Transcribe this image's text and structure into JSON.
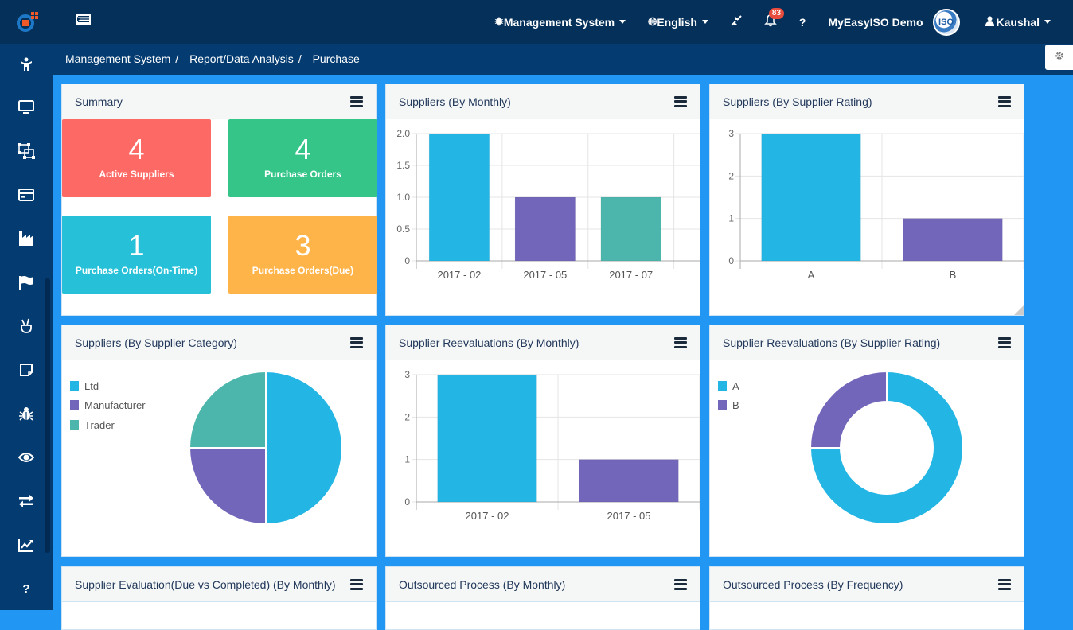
{
  "topbar": {
    "system_menu": "Management System",
    "language": "English",
    "notifications_count": "83",
    "help": "?",
    "company": "MyEasyISO Demo",
    "avatar_text": "ISO",
    "user": "Kaushal"
  },
  "breadcrumb": {
    "items": [
      "Management System",
      "Report/Data Analysis",
      "Purchase"
    ],
    "separator": "/"
  },
  "sidebar": {
    "items": [
      "person-icon",
      "monitor-icon",
      "object-group-icon",
      "credit-card-icon",
      "industry-icon",
      "flag-icon",
      "hand-peace-icon",
      "sticky-note-icon",
      "bug-icon",
      "eye-icon",
      "exchange-icon",
      "line-chart-icon",
      "question-icon"
    ]
  },
  "colors": {
    "blue": "#23b5e3",
    "purple": "#7266ba",
    "teal": "#4db6ac",
    "red": "#fd6a66",
    "green": "#35c589",
    "cyan": "#26c1d8",
    "orange": "#ffb44a"
  },
  "summary": {
    "title": "Summary",
    "tiles": [
      {
        "value": "4",
        "label": "Active Suppliers",
        "color": "#fd6a66"
      },
      {
        "value": "4",
        "label": "Purchase Orders",
        "color": "#35c589"
      },
      {
        "value": "1",
        "label": "Purchase Orders(On-Time)",
        "color": "#26c1d8"
      },
      {
        "value": "3",
        "label": "Purchase Orders(Due)",
        "color": "#ffb44a"
      }
    ]
  },
  "panels": {
    "bottom_row": [
      "Supplier Evaluation(Due vs Completed) (By Monthly)",
      "Outsourced Process (By Monthly)",
      "Outsourced Process (By Frequency)"
    ]
  },
  "chart_data": [
    {
      "id": "suppliers_monthly",
      "type": "bar",
      "title": "Suppliers (By Monthly)",
      "categories": [
        "2017 - 02",
        "2017 - 05",
        "2017 - 07"
      ],
      "values": [
        2,
        1,
        1
      ],
      "colors": [
        "#23b5e3",
        "#7266ba",
        "#4db6ac"
      ],
      "yticks": [
        "0",
        "0.5",
        "1.0",
        "1.5",
        "2.0"
      ],
      "ylim": [
        0,
        2
      ],
      "grid": true,
      "xlabel": "",
      "ylabel": ""
    },
    {
      "id": "suppliers_rating",
      "type": "bar",
      "title": "Suppliers (By Supplier Rating)",
      "categories": [
        "A",
        "B"
      ],
      "values": [
        3,
        1
      ],
      "colors": [
        "#23b5e3",
        "#7266ba"
      ],
      "yticks": [
        "0",
        "1",
        "2",
        "3"
      ],
      "ylim": [
        0,
        3
      ],
      "grid": true,
      "xlabel": "",
      "ylabel": ""
    },
    {
      "id": "suppliers_category",
      "type": "pie",
      "title": "Suppliers (By Supplier Category)",
      "categories": [
        "Ltd",
        "Manufacturer",
        "Trader"
      ],
      "values": [
        2,
        1,
        1
      ],
      "colors": [
        "#23b5e3",
        "#7266ba",
        "#4db6ac"
      ],
      "legend": "top-left"
    },
    {
      "id": "reevaluations_monthly",
      "type": "bar",
      "title": "Supplier Reevaluations (By Monthly)",
      "categories": [
        "2017 - 02",
        "2017 - 05"
      ],
      "values": [
        3,
        1
      ],
      "colors": [
        "#23b5e3",
        "#7266ba"
      ],
      "yticks": [
        "0",
        "1",
        "2",
        "3"
      ],
      "ylim": [
        0,
        3
      ],
      "grid": true,
      "xlabel": "",
      "ylabel": ""
    },
    {
      "id": "reevaluations_rating",
      "type": "pie",
      "donut": true,
      "title": "Supplier Reevaluations (By Supplier Rating)",
      "categories": [
        "A",
        "B"
      ],
      "values": [
        3,
        1
      ],
      "colors": [
        "#23b5e3",
        "#7266ba"
      ],
      "legend": "top-left"
    }
  ]
}
